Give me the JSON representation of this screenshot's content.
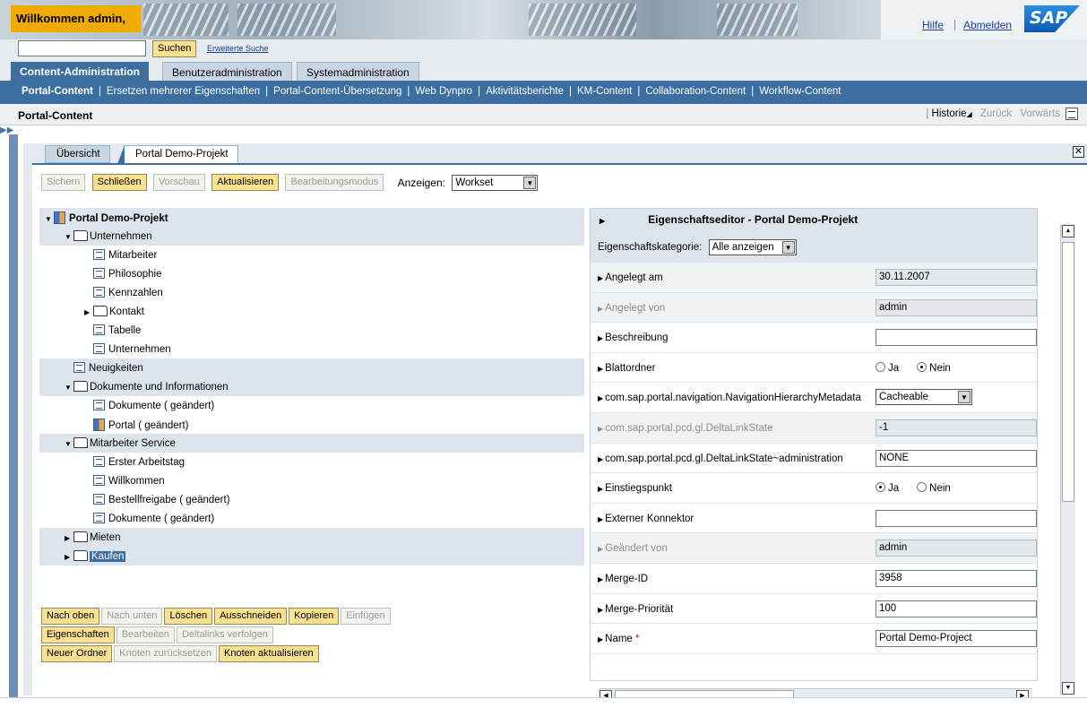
{
  "header": {
    "welcome": "Willkommen admin,",
    "help": "Hilfe",
    "logout": "Abmelden",
    "logo": "SAP"
  },
  "search": {
    "value": "",
    "button": "Suchen",
    "advanced": "Erweiterte Suche"
  },
  "top_tabs": [
    "Content-Administration",
    "Benutzeradministration",
    "Systemadministration"
  ],
  "sub_nav": [
    "Portal-Content",
    "Ersetzen mehrerer Eigenschaften",
    "Portal-Content-Übersetzung",
    "Web Dynpro",
    "Aktivitätsberichte",
    "KM-Content",
    "Collaboration-Content",
    "Workflow-Content"
  ],
  "page": {
    "title": "Portal-Content",
    "history": "Historie",
    "back": "Zurück",
    "forward": "Vorwärts"
  },
  "content_tabs": [
    "Übersicht",
    "Portal Demo-Projekt"
  ],
  "toolbar": {
    "save": "Sichern",
    "close": "Schließen",
    "preview": "Vorschau",
    "refresh": "Aktualisieren",
    "edit_mode": "Bearbeitungsmodus",
    "show_label": "Anzeigen:",
    "show_value": "Workset"
  },
  "tree": [
    {
      "label": "Portal Demo-Projekt",
      "level": 0,
      "icon": "page-icon",
      "toggle": "open",
      "bold": true,
      "shade": true
    },
    {
      "label": "Unternehmen",
      "level": 1,
      "icon": "folder-icon",
      "toggle": "open",
      "shade": true
    },
    {
      "label": "Mitarbeiter",
      "level": 2,
      "icon": "doc-icon",
      "toggle": "",
      "shade": false
    },
    {
      "label": "Philosophie",
      "level": 2,
      "icon": "doc-icon",
      "toggle": "",
      "shade": false
    },
    {
      "label": "Kennzahlen",
      "level": 2,
      "icon": "doc-icon",
      "toggle": "",
      "shade": false
    },
    {
      "label": "Kontakt",
      "level": 2,
      "icon": "folder-icon",
      "toggle": "closed",
      "shade": false
    },
    {
      "label": "Tabelle",
      "level": 2,
      "icon": "doc-icon",
      "toggle": "",
      "shade": false
    },
    {
      "label": "Unternehmen",
      "level": 2,
      "icon": "doc-icon",
      "toggle": "",
      "shade": false
    },
    {
      "label": "Neuigkeiten",
      "level": 1,
      "icon": "doc-icon",
      "toggle": "",
      "shade": true
    },
    {
      "label": "Dokumente und Informationen",
      "level": 1,
      "icon": "folder-icon",
      "toggle": "open",
      "shade": true
    },
    {
      "label": "Dokumente ( geändert)",
      "level": 2,
      "icon": "doc-icon",
      "toggle": "",
      "shade": false
    },
    {
      "label": "Portal ( geändert)",
      "level": 2,
      "icon": "page-icon",
      "toggle": "",
      "shade": false
    },
    {
      "label": "Mitarbeiter Service",
      "level": 1,
      "icon": "folder-icon",
      "toggle": "open",
      "shade": true
    },
    {
      "label": "Erster Arbeitstag",
      "level": 2,
      "icon": "doc-icon",
      "toggle": "",
      "shade": false
    },
    {
      "label": "Willkommen",
      "level": 2,
      "icon": "doc-icon",
      "toggle": "",
      "shade": false
    },
    {
      "label": "Bestellfreigabe ( geändert)",
      "level": 2,
      "icon": "doc-icon",
      "toggle": "",
      "shade": false
    },
    {
      "label": "Dokumente ( geändert)",
      "level": 2,
      "icon": "doc-icon",
      "toggle": "",
      "shade": false
    },
    {
      "label": "Mieten",
      "level": 1,
      "icon": "folder-icon",
      "toggle": "closed",
      "shade": true
    },
    {
      "label": "Kaufen",
      "level": 1,
      "icon": "folder-icon",
      "toggle": "closed",
      "shade": true,
      "selected": true
    }
  ],
  "tree_buttons": [
    [
      {
        "label": "Nach oben",
        "enabled": true
      },
      {
        "label": "Nach unten",
        "enabled": false
      },
      {
        "label": "Löschen",
        "enabled": true
      },
      {
        "label": "Ausschneiden",
        "enabled": true
      },
      {
        "label": "Kopieren",
        "enabled": true
      },
      {
        "label": "Einfügen",
        "enabled": false
      }
    ],
    [
      {
        "label": "Eigenschaften",
        "enabled": true
      },
      {
        "label": "Bearbeiten",
        "enabled": false
      },
      {
        "label": "Deltalinks verfolgen",
        "enabled": false
      }
    ],
    [
      {
        "label": "Neuer Ordner",
        "enabled": true
      },
      {
        "label": "Knoten zurücksetzen",
        "enabled": false
      },
      {
        "label": "Knoten aktualisieren",
        "enabled": true
      }
    ]
  ],
  "properties": {
    "title": "Eigenschaftseditor - Portal Demo-Projekt",
    "category_label": "Eigenschaftskategorie:",
    "category_value": "Alle anzeigen",
    "rows": [
      {
        "name": "Angelegt am",
        "type": "text",
        "value": "30.11.2007",
        "readonly": true,
        "dim": false
      },
      {
        "name": "Angelegt von",
        "type": "text",
        "value": "admin",
        "readonly": true,
        "dim": true
      },
      {
        "name": "Beschreibung",
        "type": "text",
        "value": "",
        "readonly": false,
        "dim": false
      },
      {
        "name": "Blattordner",
        "type": "radio",
        "options": [
          "Ja",
          "Nein"
        ],
        "selected": 1,
        "dim": false
      },
      {
        "name": "com.sap.portal.navigation.NavigationHierarchyMetadata",
        "type": "select",
        "value": "Cacheable",
        "dim": false
      },
      {
        "name": "com.sap.portal.pcd.gl.DeltaLinkState",
        "type": "text",
        "value": "-1",
        "readonly": true,
        "dim": true
      },
      {
        "name": "com.sap.portal.pcd.gl.DeltaLinkState~administration",
        "type": "text",
        "value": "NONE",
        "readonly": false,
        "dim": false
      },
      {
        "name": "Einstiegspunkt",
        "type": "radio",
        "options": [
          "Ja",
          "Nein"
        ],
        "selected": 0,
        "dim": false
      },
      {
        "name": "Externer Konnektor",
        "type": "text",
        "value": "",
        "readonly": false,
        "dim": false
      },
      {
        "name": "Geändert von",
        "type": "text",
        "value": "admin",
        "readonly": true,
        "dim": true
      },
      {
        "name": "Merge-ID",
        "type": "text",
        "value": "3958",
        "readonly": false,
        "dim": false
      },
      {
        "name": "Merge-Priorität",
        "type": "text",
        "value": "100",
        "readonly": false,
        "dim": false
      },
      {
        "name": "Name",
        "type": "text",
        "value": "Portal Demo-Project",
        "readonly": false,
        "dim": false,
        "required": true
      }
    ]
  }
}
